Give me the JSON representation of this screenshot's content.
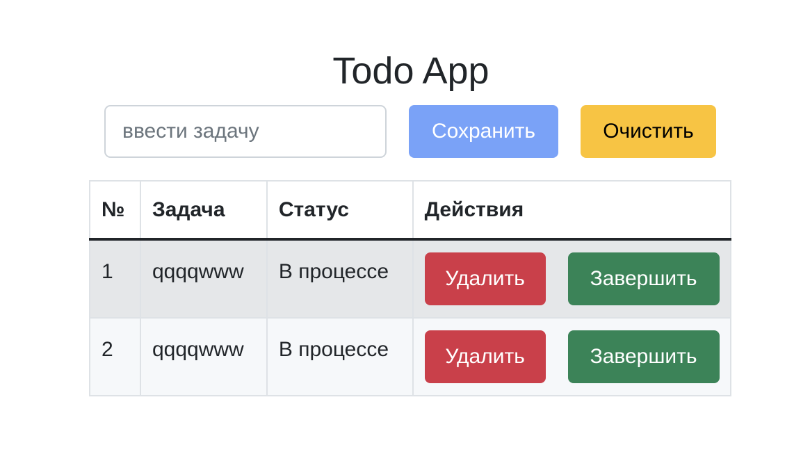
{
  "header": {
    "title": "Todo App"
  },
  "form": {
    "input_value": "",
    "input_placeholder": "ввести задачу",
    "save_label": "Сохранить",
    "clear_label": "Очистить"
  },
  "table": {
    "headers": [
      "№",
      "Задача",
      "Статус",
      "Действия"
    ],
    "rows": [
      {
        "number": "1",
        "task": "qqqqwww",
        "status": "В процессе",
        "delete_label": "Удалить",
        "complete_label": "Завершить"
      },
      {
        "number": "2",
        "task": "qqqqwww",
        "status": "В процессе",
        "delete_label": "Удалить",
        "complete_label": "Завершить"
      }
    ]
  },
  "colors": {
    "save_button": "#7aa2f7",
    "clear_button": "#f7c444",
    "delete_button": "#c9404a",
    "complete_button": "#3c8358"
  }
}
